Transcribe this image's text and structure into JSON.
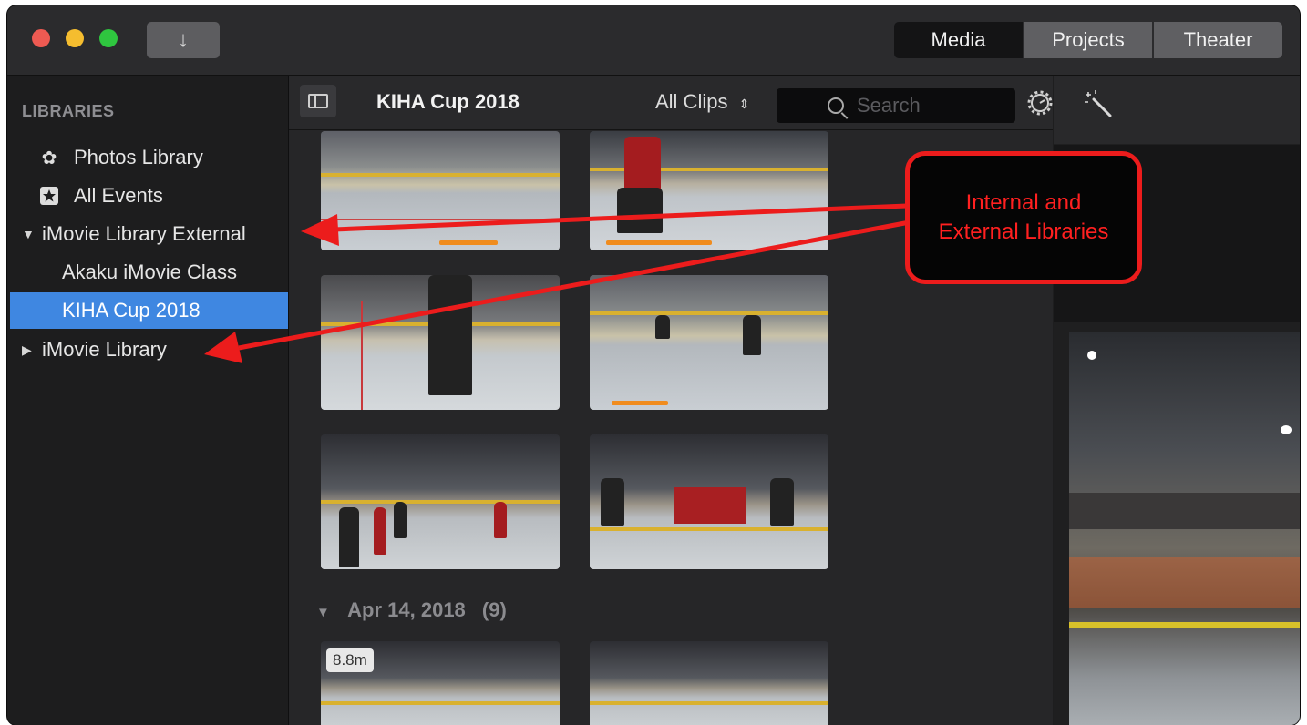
{
  "titlebar": {
    "import_icon": "down-arrow-icon",
    "tabs": [
      {
        "label": "Media",
        "active": true
      },
      {
        "label": "Projects",
        "active": false
      },
      {
        "label": "Theater",
        "active": false
      }
    ]
  },
  "sidebar": {
    "header": "LIBRARIES",
    "items": [
      {
        "label": "Photos Library",
        "icon": "photos-flower-icon"
      },
      {
        "label": "All Events",
        "icon": "star-box-icon"
      },
      {
        "label": "iMovie Library External",
        "expanded": true
      },
      {
        "label": "Akaku iMovie Class"
      },
      {
        "label": "KIHA Cup 2018",
        "selected": true
      },
      {
        "label": "iMovie Library",
        "expanded": false
      }
    ]
  },
  "browser": {
    "event_title": "KIHA Cup 2018",
    "clips_filter": "All Clips",
    "clips_filter_chevron": "⌃⌄",
    "search_placeholder": "Search",
    "date_group": {
      "label": "Apr 14, 2018",
      "count": "(9)"
    },
    "duration_badge": "8.8m"
  },
  "annotation": {
    "text_line1": "Internal and",
    "text_line2": "External Libraries",
    "color": "#ec1c1c"
  },
  "colors": {
    "selection": "#3f87e1",
    "background": "#1e1e1f"
  }
}
